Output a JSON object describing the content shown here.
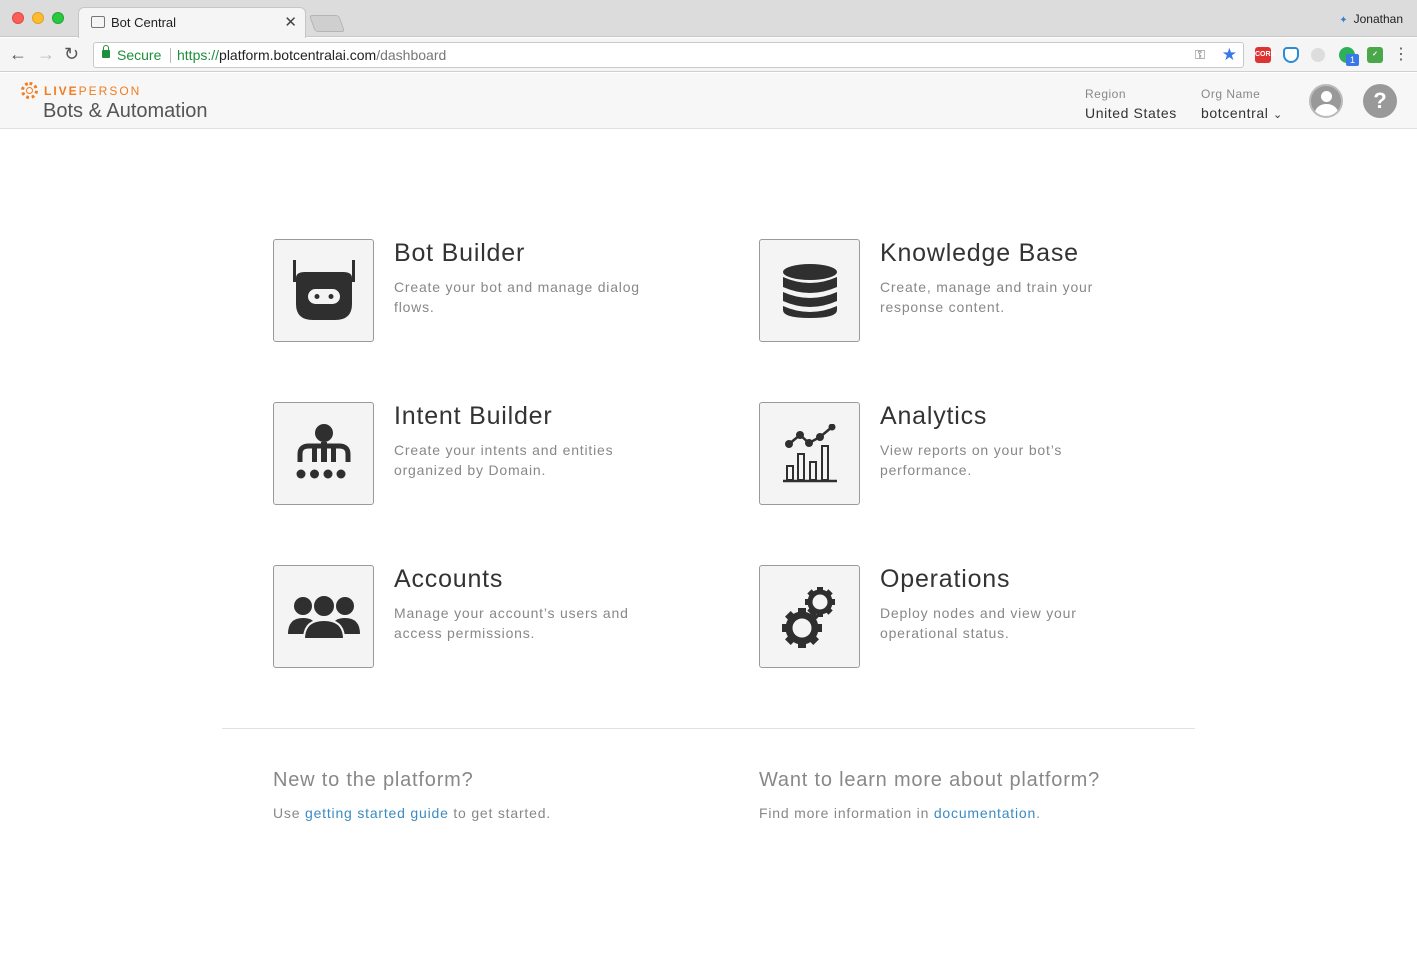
{
  "browser": {
    "tab_title": "Bot Central",
    "profile_name": "Jonathan",
    "secure_label": "Secure",
    "url_scheme": "https://",
    "url_host": "platform.botcentralai.com",
    "url_path": "/dashboard",
    "extensions": [
      "cors-icon",
      "shield-extension-icon",
      "circle-extension-icon",
      "green-extension-icon",
      "checkbox-extension-icon"
    ],
    "extension_badge": "1"
  },
  "header": {
    "brand_prefix": "LIVE",
    "brand_suffix": "PERSON",
    "product": "Bots & Automation",
    "region_label": "Region",
    "region_value": "United States",
    "org_label": "Org Name",
    "org_value": "botcentral",
    "help_glyph": "?"
  },
  "cards": [
    {
      "title": "Bot Builder",
      "description": "Create your bot and manage dialog flows.",
      "icon": "robot-icon"
    },
    {
      "title": "Knowledge Base",
      "description": "Create, manage and train your response content.",
      "icon": "database-icon"
    },
    {
      "title": "Intent Builder",
      "description": "Create your intents and entities organized by Domain.",
      "icon": "hierarchy-icon"
    },
    {
      "title": "Analytics",
      "description": "View reports on your bot’s performance.",
      "icon": "chart-icon"
    },
    {
      "title": "Accounts",
      "description": "Manage your account’s users and access permissions.",
      "icon": "users-icon"
    },
    {
      "title": "Operations",
      "description": "Deploy nodes and view your operational status.",
      "icon": "gears-icon"
    }
  ],
  "footer": {
    "left_title": "New to the platform?",
    "left_prefix": "Use ",
    "left_link": "getting started guide",
    "left_suffix": " to get started.",
    "right_title": "Want to learn more about platform?",
    "right_prefix": "Find more information in ",
    "right_link": "documentation",
    "right_suffix": "."
  },
  "colors": {
    "brand_orange": "#f07d21",
    "link_blue": "#3b8bc2",
    "secure_green": "#1e8f3a",
    "icon_dark": "#2f2f2f"
  }
}
